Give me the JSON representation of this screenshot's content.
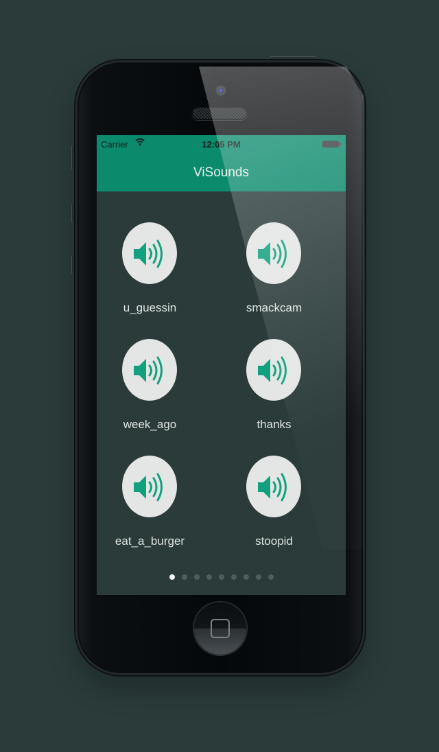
{
  "status_bar": {
    "carrier": "Carrier",
    "time": "12:05 PM"
  },
  "nav": {
    "title": "ViSounds"
  },
  "sounds": [
    {
      "label": "u_guessin",
      "icon": "speaker-volume-icon"
    },
    {
      "label": "smackcam",
      "icon": "speaker-volume-icon"
    },
    {
      "label": "week_ago",
      "icon": "speaker-volume-icon"
    },
    {
      "label": "thanks",
      "icon": "speaker-volume-icon"
    },
    {
      "label": "eat_a_burger",
      "icon": "speaker-volume-icon"
    },
    {
      "label": "stoopid",
      "icon": "speaker-volume-icon"
    }
  ],
  "pagination": {
    "total_pages": 9,
    "current_page": 1
  },
  "colors": {
    "accent": "#0b8a6c",
    "icon_green": "#12a07e",
    "background": "#2a3b3a",
    "button": "#e4e6e5"
  }
}
